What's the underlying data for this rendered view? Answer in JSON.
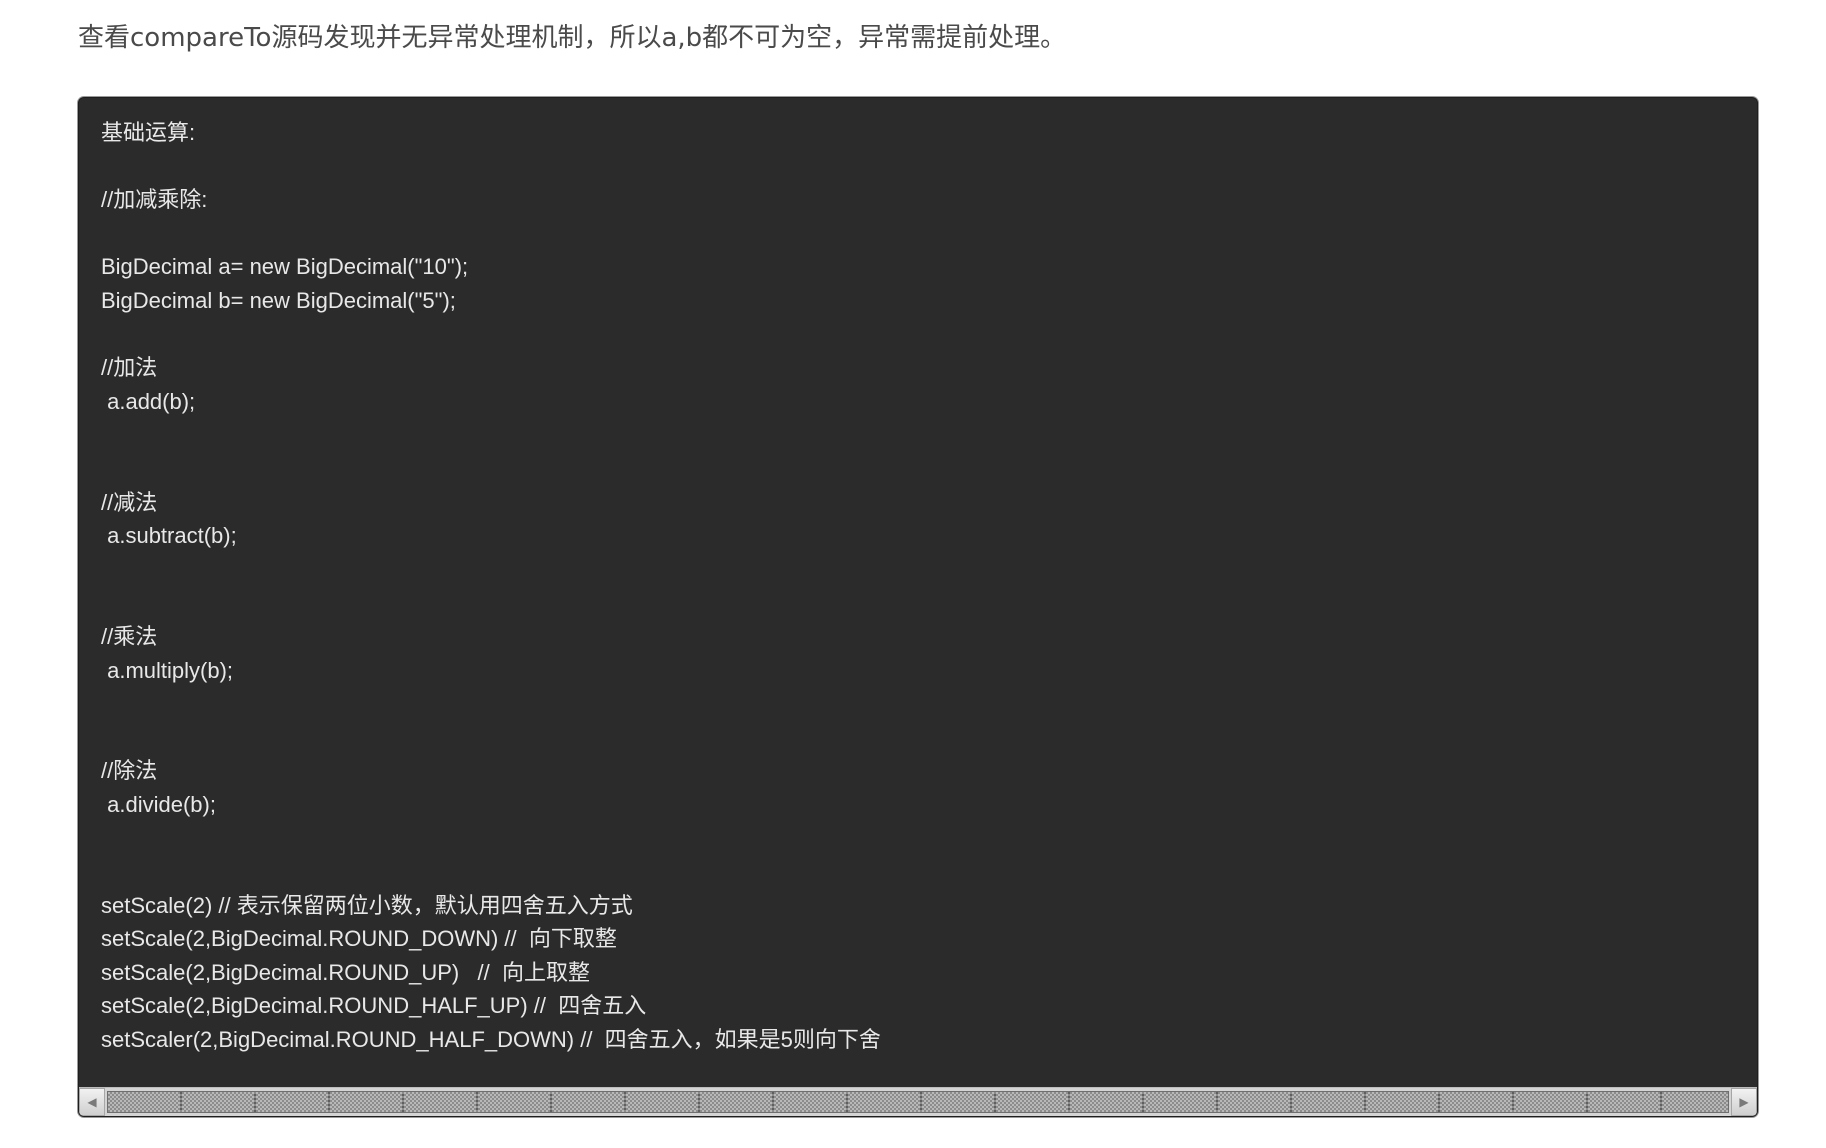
{
  "intro": {
    "text": "查看compareTo源码发现并无异常处理机制，所以a,b都不可为空，异常需提前处理。"
  },
  "code": {
    "lines": [
      "基础运算:",
      "",
      "//加减乘除:",
      "",
      "BigDecimal a= new BigDecimal(\"10\");",
      "BigDecimal b= new BigDecimal(\"5\");",
      "",
      "//加法",
      " a.add(b);",
      "",
      "",
      "//减法",
      " a.subtract(b);",
      "",
      "",
      "//乘法",
      " a.multiply(b);",
      "",
      "",
      "//除法",
      " a.divide(b);",
      "",
      "",
      "setScale(2) // 表示保留两位小数，默认用四舍五入方式",
      "setScale(2,BigDecimal.ROUND_DOWN) //  向下取整",
      "setScale(2,BigDecimal.ROUND_UP)   //  向上取整",
      "setScale(2,BigDecimal.ROUND_HALF_UP) //  四舍五入",
      "setScaler(2,BigDecimal.ROUND_HALF_DOWN) //  四舍五入，如果是5则向下舍"
    ]
  },
  "scrollbar": {
    "left_arrow": "◀",
    "right_arrow": "▶"
  }
}
